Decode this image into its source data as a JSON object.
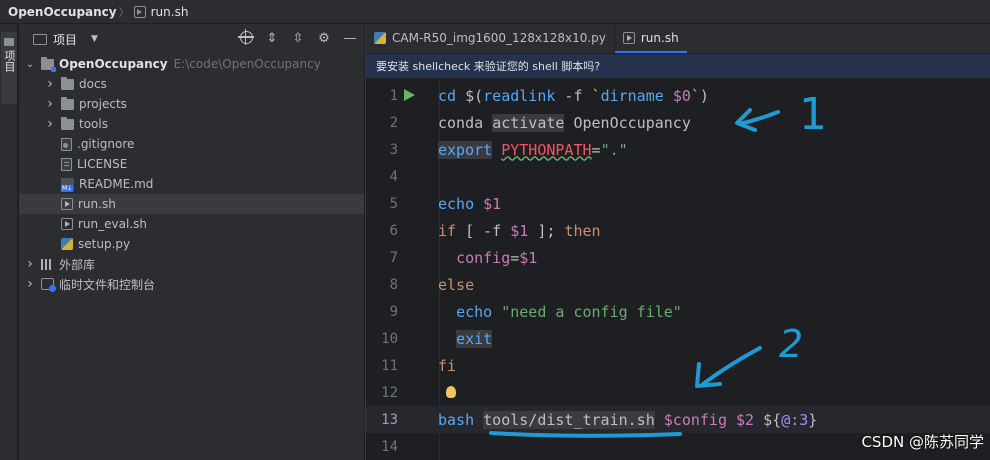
{
  "breadcrumb": {
    "project": "OpenOccupancy",
    "file": "run.sh"
  },
  "toolstrip": {
    "project_tab": "项目"
  },
  "project_panel": {
    "title": "项目",
    "tree": [
      {
        "label": "OpenOccupancy",
        "hint": "E:\\code\\OpenOccupancy",
        "icon": "folder-root-icon",
        "depth": 0,
        "expanded": true
      },
      {
        "label": "docs",
        "icon": "folder-icon",
        "depth": 1,
        "expanded": false
      },
      {
        "label": "projects",
        "icon": "folder-icon",
        "depth": 1,
        "expanded": false
      },
      {
        "label": "tools",
        "icon": "folder-icon",
        "depth": 1,
        "expanded": false
      },
      {
        "label": ".gitignore",
        "icon": "gitignore-file-icon",
        "depth": 1
      },
      {
        "label": "LICENSE",
        "icon": "text-file-icon",
        "depth": 1
      },
      {
        "label": "README.md",
        "icon": "markdown-file-icon",
        "depth": 1
      },
      {
        "label": "run.sh",
        "icon": "shell-file-icon",
        "depth": 1,
        "selected": true
      },
      {
        "label": "run_eval.sh",
        "icon": "shell-file-icon",
        "depth": 1
      },
      {
        "label": "setup.py",
        "icon": "python-file-icon",
        "depth": 1
      },
      {
        "label": "外部库",
        "icon": "library-icon",
        "depth": 0,
        "expanded": false
      },
      {
        "label": "临时文件和控制台",
        "icon": "scratch-icon",
        "depth": 0,
        "expanded": false
      }
    ]
  },
  "editor": {
    "tabs": [
      {
        "label": "CAM-R50_img1600_128x128x10.py",
        "icon": "python-file-icon",
        "active": false
      },
      {
        "label": "run.sh",
        "icon": "shell-file-icon",
        "active": true
      }
    ],
    "banner": "要安装 shellcheck 来验证您的 shell 脚本吗?",
    "line_numbers": [
      "1",
      "2",
      "3",
      "4",
      "5",
      "6",
      "7",
      "8",
      "9",
      "10",
      "11",
      "12",
      "13",
      "14"
    ],
    "current_line": 13,
    "code": {
      "l1": {
        "a": "cd ",
        "b": "$(",
        "c": "readlink",
        "d": " -f `",
        "e": "dirname",
        "f": " ",
        "g": "$0",
        "h": "`)"
      },
      "l2": {
        "a": "conda",
        "b": " ",
        "c": "activate",
        "d": " OpenOccupancy"
      },
      "l3": {
        "a": "export",
        "b": " ",
        "c": "PYTHONPATH",
        "d": "=",
        "e": "\".\""
      },
      "l5": {
        "a": "echo",
        "b": " ",
        "c": "$1"
      },
      "l6": {
        "a": "if",
        "b": " [ -f ",
        "c": "$1",
        "d": " ]; ",
        "e": "then"
      },
      "l7": {
        "a": "  ",
        "b": "config",
        "c": "=",
        "d": "$1"
      },
      "l8": {
        "a": "else"
      },
      "l9": {
        "a": "  ",
        "b": "echo",
        "c": " ",
        "d": "\"need a config file\""
      },
      "l10": {
        "a": "  ",
        "b": "exit"
      },
      "l11": {
        "a": "fi"
      },
      "l13": {
        "a": "bash",
        "b": " ",
        "c": "tools/dist_train.sh",
        "d": " ",
        "e": "$config",
        "f": " ",
        "g": "$2",
        "h": " ${",
        "i": "@:3",
        "j": "}"
      }
    }
  },
  "annotations": {
    "mark_1": "1",
    "mark_2": "2",
    "ink_color": "#1f9bd4"
  },
  "watermark": "CSDN @陈苏同学",
  "colors": {
    "keyword": "#cf8e6d",
    "command": "#56a8f5",
    "variable": "#c77dbb",
    "string": "#6aab73",
    "error": "#f75464",
    "accent": "#3574f0"
  }
}
